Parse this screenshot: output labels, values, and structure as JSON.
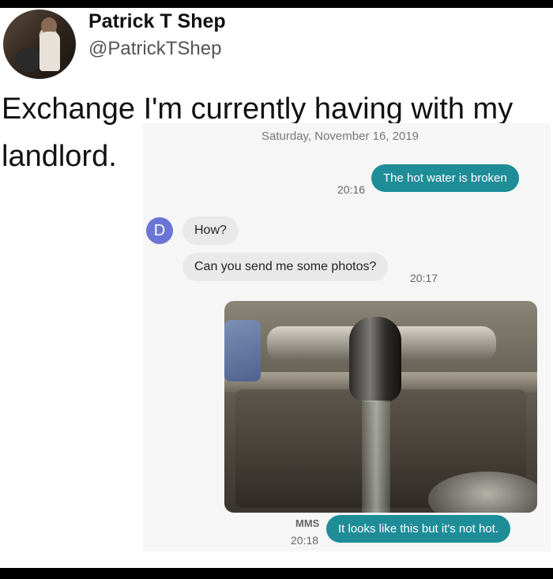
{
  "tweet": {
    "author_name": "Patrick T Shep",
    "author_handle": "@PatrickTShep",
    "text": "Exchange I'm currently having with my landlord."
  },
  "conversation": {
    "date": "Saturday, November 16, 2019",
    "contact_initial": "D",
    "messages": [
      {
        "direction": "outgoing",
        "text": "The hot water is broken",
        "time": "20:16"
      },
      {
        "direction": "incoming",
        "text": "How?"
      },
      {
        "direction": "incoming",
        "text": "Can you send me some photos?",
        "time": "20:17"
      },
      {
        "direction": "outgoing",
        "type": "MMS",
        "text": "It looks like this but it's not hot.",
        "time": "20:18"
      }
    ],
    "mms_label": "MMS"
  },
  "colors": {
    "outgoing_bubble": "#1e8d98",
    "incoming_bubble": "#e9e9e9",
    "contact_avatar": "#6a75d6"
  }
}
